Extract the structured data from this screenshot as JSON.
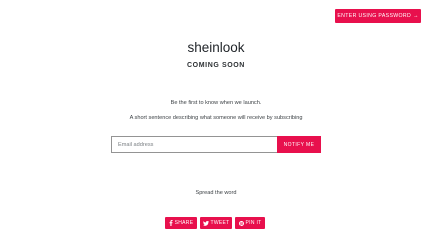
{
  "header": {
    "password_button_label": "ENTER USING PASSWORD",
    "password_button_icon": "arrow-right-icon",
    "password_button_arrow": "→"
  },
  "brand": {
    "name": "sheinlook",
    "status": "COMING SOON"
  },
  "signup": {
    "tagline": "Be the first to know when we launch.",
    "description": "A short sentence describing what someone will receive by subscribing",
    "email_placeholder": "Email address",
    "email_value": "",
    "submit_label": "NOTIFY ME"
  },
  "share": {
    "heading": "Spread the word",
    "buttons": [
      {
        "label": "SHARE",
        "icon": "facebook-icon"
      },
      {
        "label": "TWEET",
        "icon": "twitter-icon"
      },
      {
        "label": "PIN IT",
        "icon": "pinterest-icon"
      }
    ]
  },
  "colors": {
    "accent": "#e8104d",
    "text": "#3d4246",
    "heading": "#1f2328",
    "background": "#ffffff",
    "input_border": "#949494"
  }
}
